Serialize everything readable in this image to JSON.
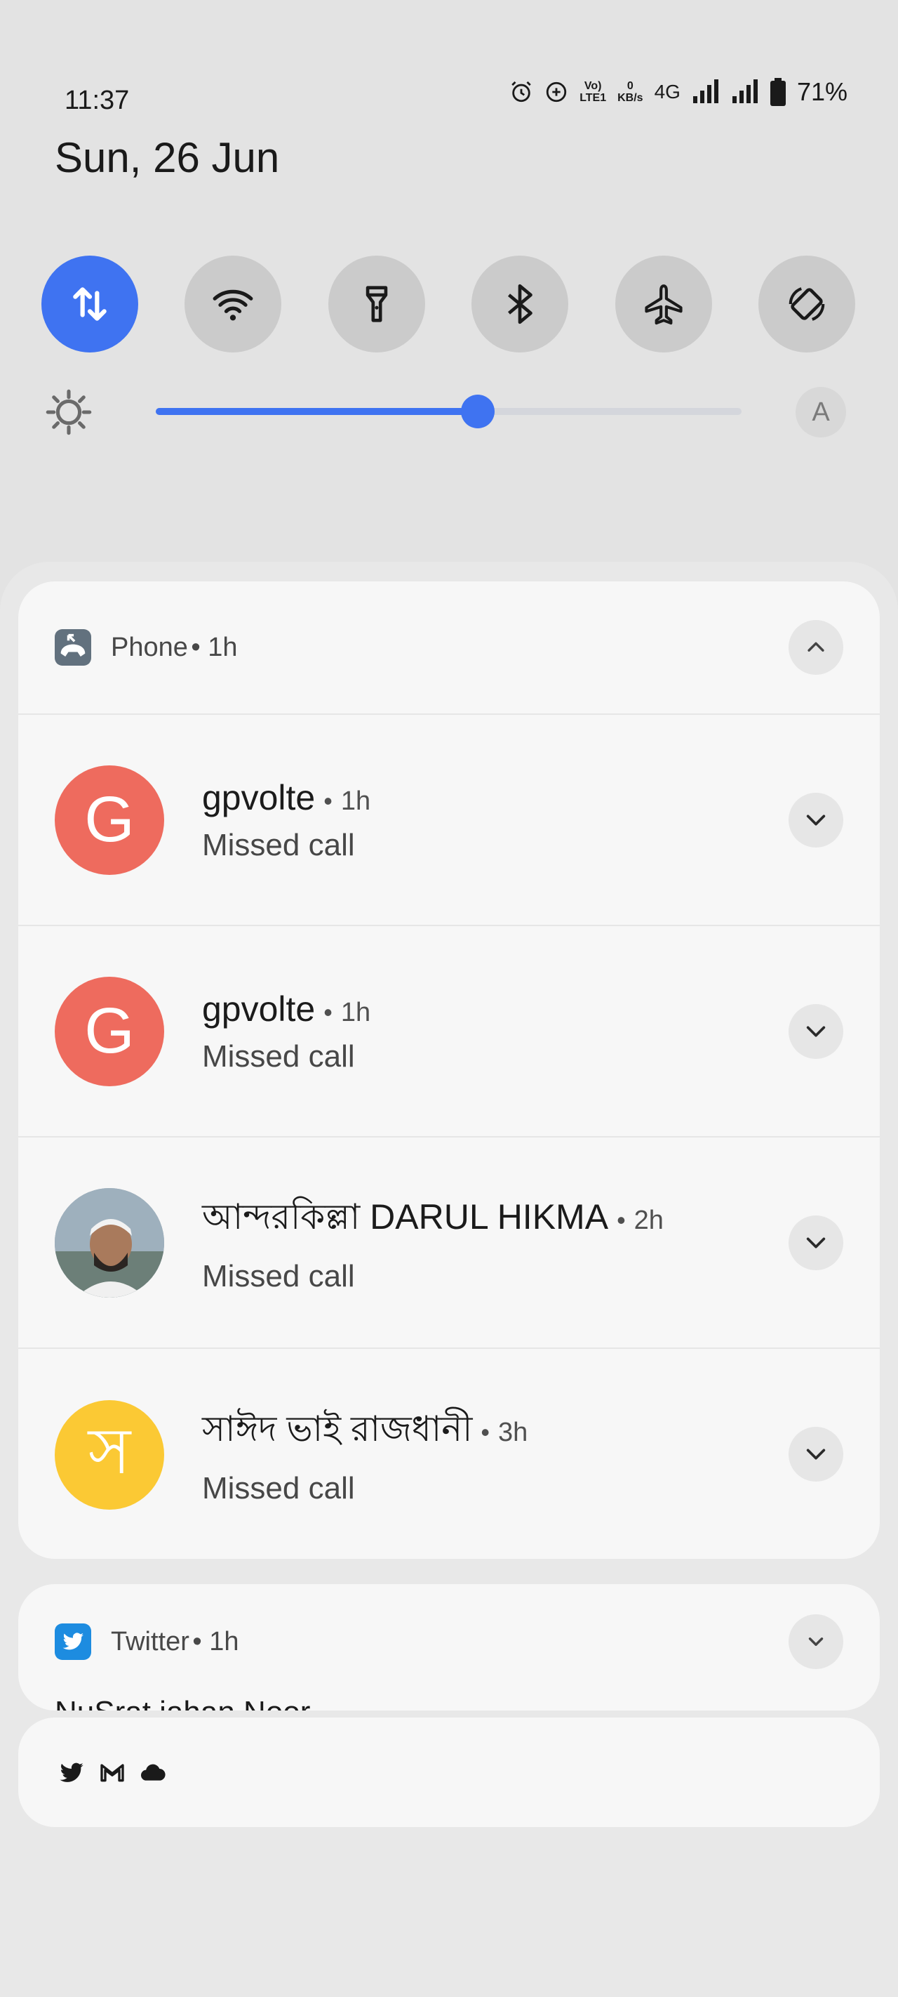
{
  "status": {
    "time": "11:37",
    "volte_top": "Vo)",
    "volte_bottom": "LTE1",
    "speed_value": "0",
    "speed_unit": "KB/s",
    "network": "4G",
    "battery": "71%"
  },
  "header": {
    "date": "Sun, 26 Jun"
  },
  "quick_settings": {
    "tiles": [
      {
        "icon": "mobile-data-icon",
        "active": true
      },
      {
        "icon": "wifi-icon",
        "active": false
      },
      {
        "icon": "flashlight-icon",
        "active": false
      },
      {
        "icon": "bluetooth-icon",
        "active": false
      },
      {
        "icon": "airplane-icon",
        "active": false
      },
      {
        "icon": "auto-rotate-icon",
        "active": false
      }
    ],
    "brightness": {
      "level": 0.55,
      "auto_label": "A"
    }
  },
  "phone_group": {
    "app_name": "Phone",
    "time": "• 1h",
    "notifications": [
      {
        "avatar_letter": "G",
        "avatar_color": "#ee6b5e",
        "title": "gpvolte",
        "time": "1h",
        "body": "Missed call"
      },
      {
        "avatar_letter": "G",
        "avatar_color": "#ee6b5e",
        "title": "gpvolte",
        "time": "1h",
        "body": "Missed call"
      },
      {
        "avatar_letter": "",
        "avatar_color": "#8a98a6",
        "title": "আন্দরকিল্লা DARUL HIKMA",
        "time": "2h",
        "body": "Missed call"
      },
      {
        "avatar_letter": "স",
        "avatar_color": "#fbc934",
        "title": "সাঈদ ভাই রাজধানী",
        "time": "3h",
        "body": "Missed call"
      }
    ]
  },
  "twitter_group": {
    "app_name": "Twitter",
    "time": "• 1h",
    "peek_text": "NuSrat jahan Noor"
  },
  "summary": {
    "icons": [
      "twitter-icon",
      "gmail-icon",
      "cloud-icon"
    ]
  },
  "colors": {
    "accent": "#3f73f1",
    "tile_inactive": "#cbcbcb"
  }
}
